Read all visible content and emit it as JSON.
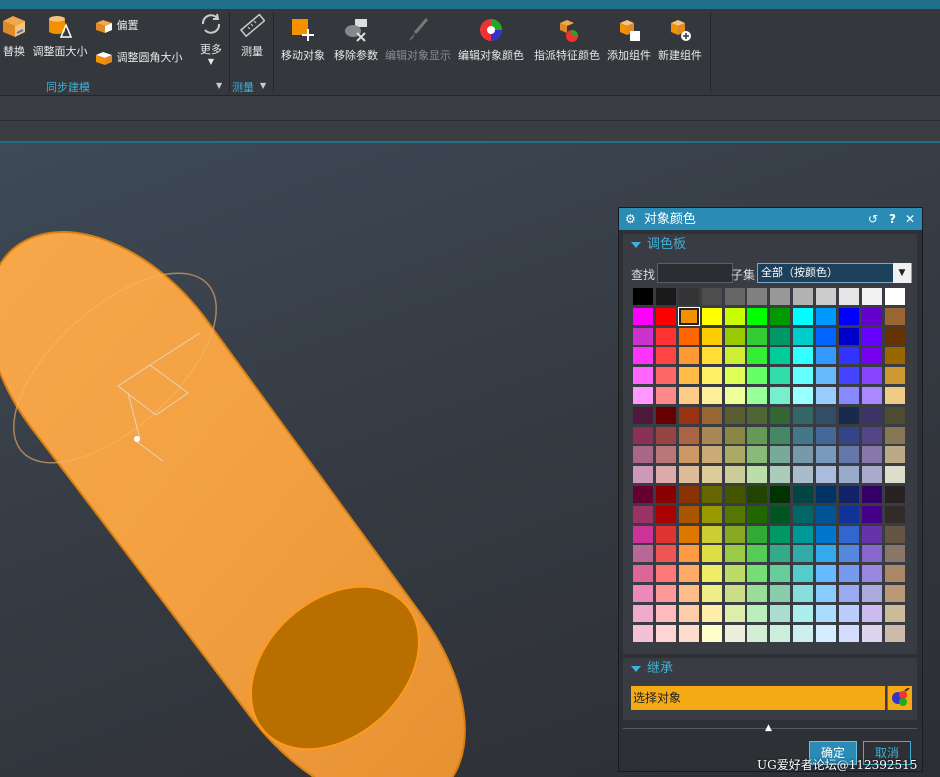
{
  "ribbon": {
    "buttons": [
      {
        "label": "替换"
      },
      {
        "label": "调整面大小"
      },
      {
        "label": "偏置"
      },
      {
        "label": "调整圆角大小"
      },
      {
        "label": "更多"
      },
      {
        "label": "测量"
      },
      {
        "label": "移动对象"
      },
      {
        "label": "移除参数"
      },
      {
        "label": "编辑对象显示"
      },
      {
        "label": "编辑对象颜色"
      },
      {
        "label": "指派特征颜色"
      },
      {
        "label": "添加组件"
      },
      {
        "label": "新建组件"
      }
    ],
    "groups": {
      "sync": "同步建模",
      "measure": "测量"
    }
  },
  "dialog": {
    "title": "对象颜色",
    "palette_section": "调色板",
    "find_label": "查找",
    "find_value": "",
    "subset_label": "子集",
    "subset_value": "全部（按颜色）",
    "inherit_section": "继承",
    "select_object": "选择对象",
    "ok": "确定",
    "cancel": "取消",
    "selected_color": "#f29200",
    "colors": [
      [
        "#000000",
        "#1a1a1a",
        "#333333",
        "#4d4d4d",
        "#666666",
        "#808080",
        "#999999",
        "#b3b3b3",
        "#cccccc",
        "#e6e6e6",
        "#f2f2f2",
        "#ffffff"
      ],
      [
        "#ff00ff",
        "#ff0000",
        "#f29200",
        "#ffff00",
        "#c8ff00",
        "#00ff00",
        "#009900",
        "#00ffff",
        "#0099ff",
        "#0000ff",
        "#6600cc",
        "#996633"
      ],
      [
        "#cc33cc",
        "#ff3333",
        "#ff6600",
        "#ffcc00",
        "#99cc00",
        "#33cc33",
        "#009966",
        "#00cccc",
        "#0066ff",
        "#0000cc",
        "#6600ff",
        "#663300"
      ],
      [
        "#ff33ff",
        "#ff4444",
        "#ff9933",
        "#ffdd33",
        "#ccee33",
        "#33ee33",
        "#00cc99",
        "#33ffff",
        "#3399ff",
        "#3333ff",
        "#7700ee",
        "#996600"
      ],
      [
        "#ff66ff",
        "#ff6666",
        "#ffbb44",
        "#ffee66",
        "#ddff55",
        "#66ff66",
        "#33ddaa",
        "#66ffff",
        "#66bbff",
        "#4444ff",
        "#8844ff",
        "#cc9933"
      ],
      [
        "#ff99ff",
        "#ff8888",
        "#ffcc88",
        "#ffee99",
        "#eeff99",
        "#99ff99",
        "#77eecc",
        "#99ffff",
        "#99ccff",
        "#8888ff",
        "#aa88ff",
        "#eecc88"
      ],
      [
        "#4d1a3d",
        "#660000",
        "#993311",
        "#996633",
        "#5c5c33",
        "#4d6633",
        "#336633",
        "#336666",
        "#334d66",
        "#1a2a4d",
        "#3d3366",
        "#4d4d33"
      ],
      [
        "#883355",
        "#994444",
        "#aa6644",
        "#aa8855",
        "#888844",
        "#669955",
        "#448866",
        "#447788",
        "#446699",
        "#334488",
        "#554488",
        "#887755"
      ],
      [
        "#aa6688",
        "#bb7777",
        "#cc9966",
        "#ccaa77",
        "#aaaa66",
        "#88bb77",
        "#77aa99",
        "#7799aa",
        "#7799bb",
        "#6677aa",
        "#8877aa",
        "#bbaa88"
      ],
      [
        "#cc99bb",
        "#ddaaaa",
        "#ddbb99",
        "#ddcc99",
        "#cccc99",
        "#bbddaa",
        "#aaccbb",
        "#aabbcc",
        "#aabbdd",
        "#99aacc",
        "#aaaacc",
        "#ddddcc"
      ],
      [
        "#660033",
        "#880000",
        "#883300",
        "#666600",
        "#445500",
        "#224400",
        "#003300",
        "#004444",
        "#003366",
        "#112266",
        "#330066",
        "#2a2222"
      ],
      [
        "#993366",
        "#aa0000",
        "#aa5500",
        "#999900",
        "#557700",
        "#226600",
        "#005522",
        "#006666",
        "#005599",
        "#113399",
        "#440088",
        "#332a2a"
      ],
      [
        "#cc3399",
        "#dd3333",
        "#dd7700",
        "#cccc33",
        "#88aa22",
        "#33aa33",
        "#009966",
        "#009999",
        "#0077cc",
        "#3366cc",
        "#6633aa",
        "#665544"
      ],
      [
        "#bb6699",
        "#ee5555",
        "#ff9944",
        "#dddd44",
        "#99cc44",
        "#55cc55",
        "#33aa88",
        "#33aaaa",
        "#33aaee",
        "#5588dd",
        "#8866cc",
        "#887766"
      ],
      [
        "#dd6699",
        "#ff7777",
        "#ffaa66",
        "#eeee66",
        "#bbdd66",
        "#77dd77",
        "#66cc99",
        "#55cccc",
        "#66bbff",
        "#7799ee",
        "#9988dd",
        "#aa8866"
      ],
      [
        "#ee88bb",
        "#ff9999",
        "#ffbb88",
        "#eeee88",
        "#ccdd88",
        "#99dd99",
        "#88ccaa",
        "#88dddd",
        "#88ccff",
        "#99aaee",
        "#aaaadd",
        "#bb9977"
      ],
      [
        "#f0aacc",
        "#ffbbbb",
        "#ffccaa",
        "#ffeeaa",
        "#ddeeaa",
        "#bbeebb",
        "#aaddcc",
        "#aaeeee",
        "#aaddff",
        "#bbccff",
        "#ccbbee",
        "#ccbb99"
      ],
      [
        "#f4c0d4",
        "#ffd4d4",
        "#ffddcc",
        "#ffffcc",
        "#eeeedd",
        "#d4eed4",
        "#cceedd",
        "#cceeee",
        "#d4eeff",
        "#d4ddff",
        "#ddd4ee",
        "#ccbbaa"
      ]
    ]
  },
  "watermark": "UG爱好者论坛@112392515"
}
